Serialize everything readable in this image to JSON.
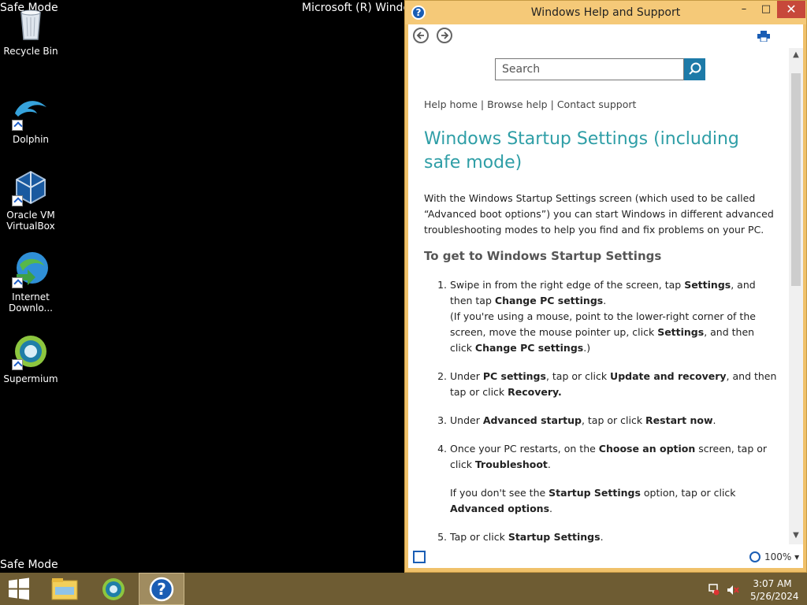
{
  "desktop": {
    "safe_mode_top": "Safe Mode",
    "safe_mode_bottom": "Safe Mode",
    "build_text": "Microsoft (R) Windo",
    "icons": [
      {
        "label": "Recycle Bin",
        "icon": "recycle-bin-icon"
      },
      {
        "label": "Dolphin",
        "icon": "dolphin-icon"
      },
      {
        "label": "Oracle VM VirtualBox",
        "icon": "virtualbox-icon"
      },
      {
        "label": "Internet Downlo...",
        "icon": "internet-download-manager-icon"
      },
      {
        "label": "Supermium",
        "icon": "supermium-icon"
      }
    ]
  },
  "help_window": {
    "title": "Windows Help and Support",
    "controls": {
      "minimize": "–",
      "maximize": "□",
      "close": "✕"
    },
    "search": {
      "placeholder": "Search"
    },
    "breadcrumbs": [
      "Help home",
      "Browse help",
      "Contact support"
    ],
    "separator": "|",
    "page_title": "Windows Startup Settings (including safe mode)",
    "intro": "With the Windows Startup Settings screen (which used to be called “Advanced boot options”) you can start Windows in different advanced troubleshooting modes to help you find and fix problems on your PC.",
    "subheading": "To get to Windows Startup Settings",
    "steps": {
      "s1a": "Swipe in from the right edge of the screen, tap ",
      "s1b": "Settings",
      "s1c": ", and then tap ",
      "s1d": "Change PC settings",
      "s1e": ".",
      "s1f": "(If you're using a mouse, point to the lower-right corner of the screen, move the mouse pointer up, click ",
      "s1g": "Settings",
      "s1h": ", and then click ",
      "s1i": "Change PC settings",
      "s1j": ".)",
      "s2a": "Under ",
      "s2b": "PC settings",
      "s2c": ", tap or click ",
      "s2d": "Update and recovery",
      "s2e": ", and then tap or click ",
      "s2f": "Recovery.",
      "s3a": "Under ",
      "s3b": "Advanced startup",
      "s3c": ", tap or click ",
      "s3d": "Restart now",
      "s3e": ".",
      "s4a": "Once your PC restarts, on the ",
      "s4b": "Choose an option",
      "s4c": " screen, tap or click ",
      "s4d": "Troubleshoot",
      "s4e": ".",
      "s4f": "If you don't see the ",
      "s4g": "Startup Settings",
      "s4h": " option, tap or click ",
      "s4i": "Advanced options",
      "s4j": ".",
      "s5a": "Tap or click ",
      "s5b": "Startup Settings",
      "s5c": "."
    },
    "zoom": "100%",
    "colors": {
      "title_bar": "#f5c978",
      "heading": "#2e9ea6",
      "search_button": "#1d7aa8",
      "close_button": "#c7483a"
    }
  },
  "taskbar": {
    "time": "3:07 AM",
    "date": "5/26/2024",
    "items": [
      "start-icon",
      "file-explorer-icon",
      "supermium-icon",
      "help-and-support-icon"
    ]
  }
}
